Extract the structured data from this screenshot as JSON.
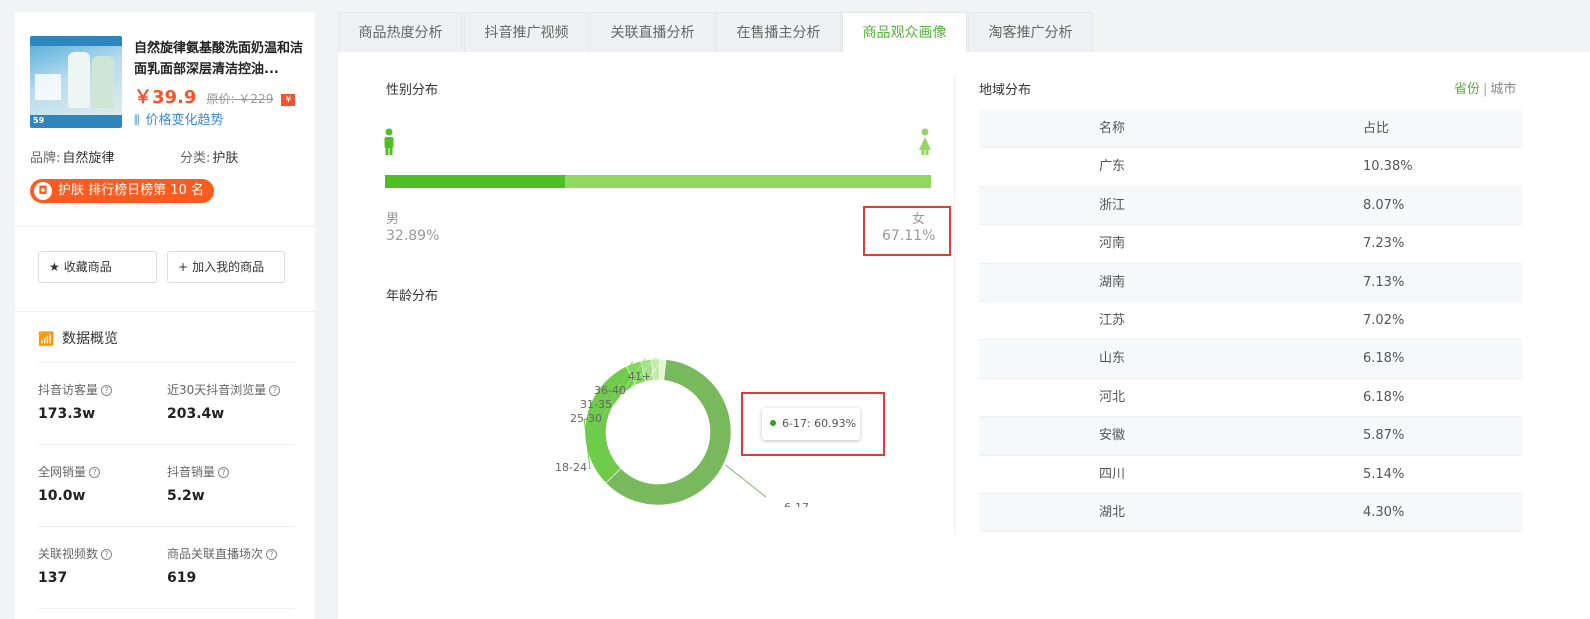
{
  "product": {
    "thumb_badge": "59",
    "title": "自然旋律氨基酸洗面奶温和洁面乳面部深层清洁控油...",
    "price": "￥39.9",
    "original_price": "原价: ￥229",
    "original_tag": "¥",
    "price_trend": "价格变化趋势",
    "brand_label": "品牌:",
    "brand": "自然旋律",
    "category_label": "分类:",
    "category": "护肤",
    "rank_text": "护肤 排行榜日榜第 10 名"
  },
  "actions": {
    "favorite": "收藏商品",
    "add_mine": "加入我的商品"
  },
  "overview": {
    "title": "数据概览",
    "stats": [
      {
        "label": "抖音访客量",
        "value": "173.3w"
      },
      {
        "label": "近30天抖音浏览量",
        "value": "203.4w"
      },
      {
        "label": "全网销量",
        "value": "10.0w"
      },
      {
        "label": "抖音销量",
        "value": "5.2w"
      },
      {
        "label": "关联视频数",
        "value": "137"
      },
      {
        "label": "商品关联直播场次",
        "value": "619"
      }
    ]
  },
  "tabs": [
    "商品热度分析",
    "抖音推广视频",
    "关联直播分析",
    "在售播主分析",
    "商品观众画像",
    "淘客推广分析"
  ],
  "active_tab": 4,
  "gender": {
    "title": "性别分布",
    "male_label": "男",
    "male_pct": "32.89%",
    "male_value": 32.89,
    "female_label": "女",
    "female_pct": "67.11%",
    "colors": {
      "male": "#4fbe26",
      "female": "#92d860"
    }
  },
  "age": {
    "title": "年龄分布",
    "tooltip": "6-17: 60.93%",
    "segments": [
      {
        "label": "6-17",
        "value": 60.93,
        "color": "#79b95e"
      },
      {
        "label": "18-24",
        "value": 30.2,
        "color": "#6fcb4a"
      },
      {
        "label": "25-30",
        "value": 3.3,
        "color": "#7fd85a"
      },
      {
        "label": "31-35",
        "value": 2.4,
        "color": "#a4e184"
      },
      {
        "label": "36-40",
        "value": 1.8,
        "color": "#c2ebaa"
      },
      {
        "label": "41+",
        "value": 1.37,
        "color": "#e3f5d6"
      }
    ]
  },
  "region": {
    "title": "地域分布",
    "toggle_on": "省份",
    "toggle_sep": "|",
    "toggle_off": "城市",
    "col_name": "名称",
    "col_pct": "占比",
    "rows": [
      {
        "name": "广东",
        "pct": "10.38%"
      },
      {
        "name": "浙江",
        "pct": "8.07%"
      },
      {
        "name": "河南",
        "pct": "7.23%"
      },
      {
        "name": "湖南",
        "pct": "7.13%"
      },
      {
        "name": "江苏",
        "pct": "7.02%"
      },
      {
        "name": "山东",
        "pct": "6.18%"
      },
      {
        "name": "河北",
        "pct": "6.18%"
      },
      {
        "name": "安徽",
        "pct": "5.87%"
      },
      {
        "name": "四川",
        "pct": "5.14%"
      },
      {
        "name": "湖北",
        "pct": "4.30%"
      }
    ]
  }
}
